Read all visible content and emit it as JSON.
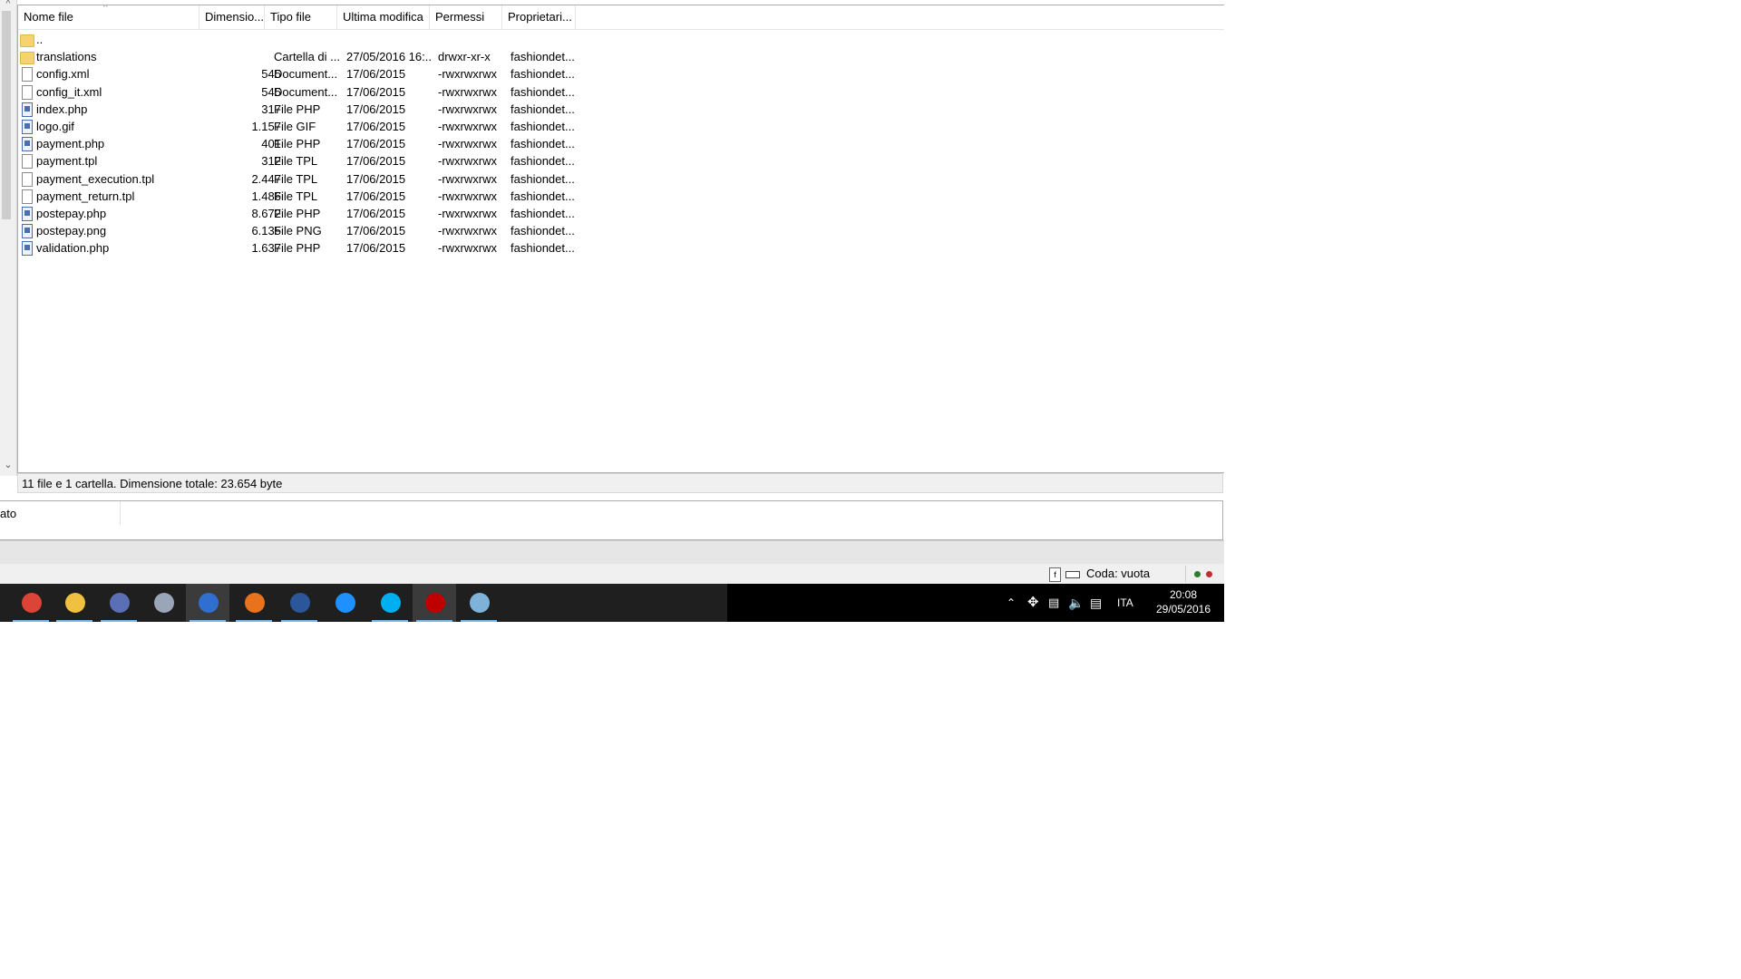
{
  "file_panel": {
    "columns": [
      "Nome file",
      "Dimensio...",
      "Tipo file",
      "Ultima modifica",
      "Permessi",
      "Proprietari..."
    ],
    "rows": [
      {
        "icon": "folder",
        "name": "..",
        "size": "",
        "type": "",
        "date": "",
        "perm": "",
        "owner": ""
      },
      {
        "icon": "folder",
        "name": "translations",
        "size": "",
        "type": "Cartella di ...",
        "date": "27/05/2016 16:...",
        "perm": "drwxr-xr-x",
        "owner": "fashiondet..."
      },
      {
        "icon": "doc",
        "name": "config.xml",
        "size": "545",
        "type": "Document...",
        "date": "17/06/2015",
        "perm": "-rwxrwxrwx",
        "owner": "fashiondet..."
      },
      {
        "icon": "doc",
        "name": "config_it.xml",
        "size": "545",
        "type": "Document...",
        "date": "17/06/2015",
        "perm": "-rwxrwxrwx",
        "owner": "fashiondet..."
      },
      {
        "icon": "php",
        "name": "index.php",
        "size": "317",
        "type": "File PHP",
        "date": "17/06/2015",
        "perm": "-rwxrwxrwx",
        "owner": "fashiondet..."
      },
      {
        "icon": "img",
        "name": "logo.gif",
        "size": "1.157",
        "type": "File GIF",
        "date": "17/06/2015",
        "perm": "-rwxrwxrwx",
        "owner": "fashiondet..."
      },
      {
        "icon": "php",
        "name": "payment.php",
        "size": "401",
        "type": "File PHP",
        "date": "17/06/2015",
        "perm": "-rwxrwxrwx",
        "owner": "fashiondet..."
      },
      {
        "icon": "doc",
        "name": "payment.tpl",
        "size": "312",
        "type": "File TPL",
        "date": "17/06/2015",
        "perm": "-rwxrwxrwx",
        "owner": "fashiondet..."
      },
      {
        "icon": "doc",
        "name": "payment_execution.tpl",
        "size": "2.447",
        "type": "File TPL",
        "date": "17/06/2015",
        "perm": "-rwxrwxrwx",
        "owner": "fashiondet..."
      },
      {
        "icon": "doc",
        "name": "payment_return.tpl",
        "size": "1.486",
        "type": "File TPL",
        "date": "17/06/2015",
        "perm": "-rwxrwxrwx",
        "owner": "fashiondet..."
      },
      {
        "icon": "php",
        "name": "postepay.php",
        "size": "8.672",
        "type": "File PHP",
        "date": "17/06/2015",
        "perm": "-rwxrwxrwx",
        "owner": "fashiondet..."
      },
      {
        "icon": "img",
        "name": "postepay.png",
        "size": "6.135",
        "type": "File PNG",
        "date": "17/06/2015",
        "perm": "-rwxrwxrwx",
        "owner": "fashiondet..."
      },
      {
        "icon": "php",
        "name": "validation.php",
        "size": "1.637",
        "type": "File PHP",
        "date": "17/06/2015",
        "perm": "-rwxrwxrwx",
        "owner": "fashiondet..."
      }
    ],
    "status_text": "11 file e 1 cartella. Dimensione totale: 23.654 byte"
  },
  "log_panel": {
    "label": "ato"
  },
  "statusbar": {
    "queue": "Coda: vuota",
    "icon_left": "f"
  },
  "taskbar": {
    "apps": [
      {
        "name": "chrome-icon",
        "color": "#db4437"
      },
      {
        "name": "file-explorer-icon",
        "color": "#f0c040"
      },
      {
        "name": "outlook-icon",
        "color": "#5a6fb5"
      },
      {
        "name": "moon-app-icon",
        "color": "#9aa6b8"
      },
      {
        "name": "network-tool-icon",
        "color": "#2f6fcf"
      },
      {
        "name": "firefox-icon",
        "color": "#e8731c"
      },
      {
        "name": "word-icon",
        "color": "#2b579a"
      },
      {
        "name": "internet-explorer-icon",
        "color": "#1e90ff"
      },
      {
        "name": "skype-icon",
        "color": "#00aff0"
      },
      {
        "name": "filezilla-icon",
        "color": "#bf0000"
      },
      {
        "name": "notes-app-icon",
        "color": "#7fb2d8"
      }
    ],
    "language": "ITA",
    "time": "20:08",
    "date": "29/05/2016"
  }
}
